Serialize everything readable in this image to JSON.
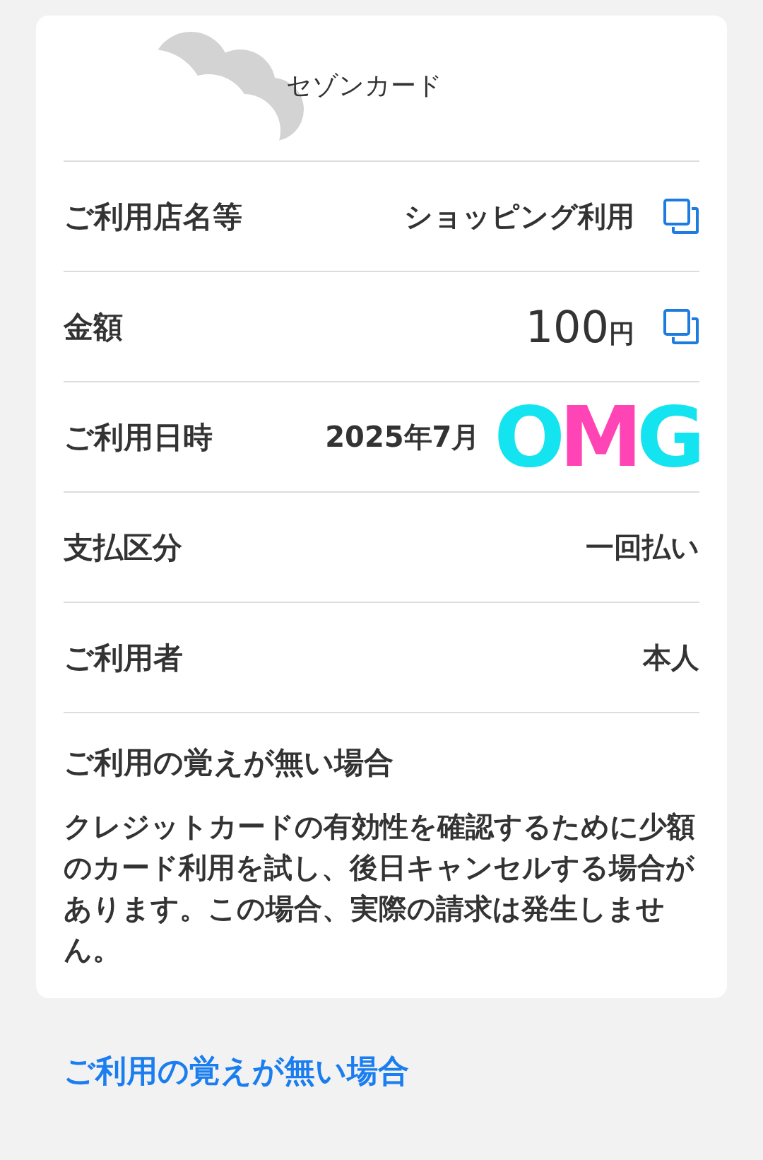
{
  "header": {
    "card_name": "セゾンカード"
  },
  "rows": [
    {
      "label": "ご利用店名等",
      "value": "ショッピング利用",
      "copyable": true
    },
    {
      "label": "金額",
      "value": "100",
      "unit": "円",
      "copyable": true
    },
    {
      "label": "ご利用日時",
      "value": "2025年7月",
      "sticker": "OMG",
      "copyable": false
    },
    {
      "label": "支払区分",
      "value": "一回払い",
      "copyable": false
    },
    {
      "label": "ご利用者",
      "value": "本人",
      "copyable": false
    }
  ],
  "notice": {
    "title": "ご利用の覚えが無い場合",
    "body": "クレジットカードの有効性を確認するために少額のカード利用を試し、後日キャンセルする場合があります。この場合、実際の請求は発生しません。"
  },
  "link": "ご利用の覚えが無い場合"
}
